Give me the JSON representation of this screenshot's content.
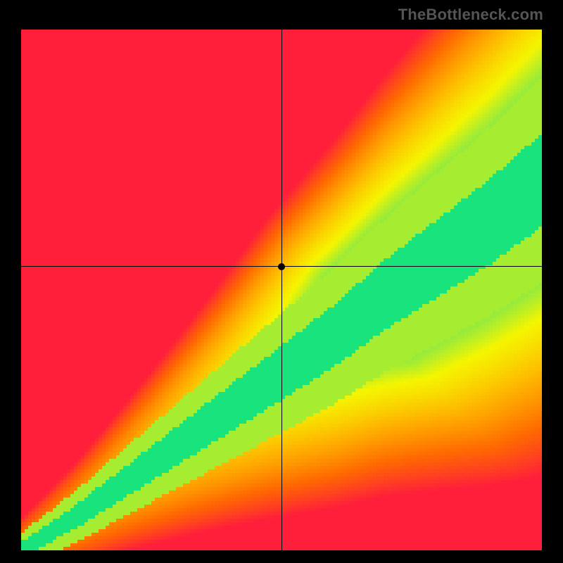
{
  "attribution": "TheBottleneck.com",
  "chart_data": {
    "type": "heatmap",
    "title": "",
    "xlabel": "",
    "ylabel": "",
    "xlim": [
      0,
      1
    ],
    "ylim": [
      0,
      1
    ],
    "grid": false,
    "legend": false,
    "crosshair": {
      "x": 0.5,
      "y": 0.545
    },
    "marker": {
      "x": 0.5,
      "y": 0.545
    },
    "optimal_curve": {
      "description": "green optimal band along diagonal; value field encodes squared distance from band center (0 = green, 1 = red)",
      "points": [
        {
          "x": 0.0,
          "y": 0.0
        },
        {
          "x": 0.1,
          "y": 0.06
        },
        {
          "x": 0.2,
          "y": 0.13
        },
        {
          "x": 0.3,
          "y": 0.2
        },
        {
          "x": 0.4,
          "y": 0.27
        },
        {
          "x": 0.5,
          "y": 0.34
        },
        {
          "x": 0.6,
          "y": 0.41
        },
        {
          "x": 0.7,
          "y": 0.49
        },
        {
          "x": 0.8,
          "y": 0.56
        },
        {
          "x": 0.9,
          "y": 0.63
        },
        {
          "x": 1.0,
          "y": 0.71
        }
      ],
      "band_halfwidth_at_x0": 0.015,
      "band_halfwidth_at_x1": 0.09
    },
    "color_stops": [
      {
        "t": 0.0,
        "color": "#00e28a"
      },
      {
        "t": 0.1,
        "color": "#7fe84a"
      },
      {
        "t": 0.22,
        "color": "#f5f500"
      },
      {
        "t": 0.45,
        "color": "#ffb000"
      },
      {
        "t": 0.7,
        "color": "#ff6a00"
      },
      {
        "t": 1.0,
        "color": "#ff1f3a"
      }
    ]
  }
}
